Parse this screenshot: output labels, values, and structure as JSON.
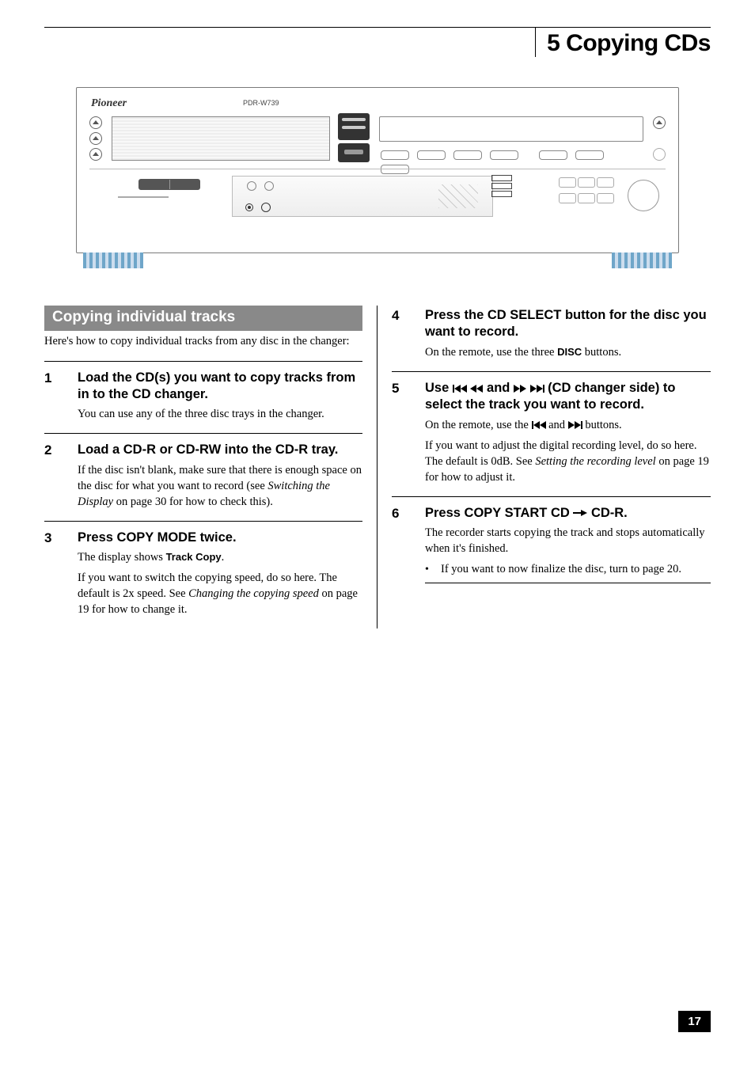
{
  "header": {
    "section_title": "5 Copying CDs"
  },
  "device": {
    "brand": "Pioneer",
    "model": "PDR-W739"
  },
  "subsection": {
    "title": "Copying individual tracks",
    "intro": "Here's how to copy individual tracks from any disc in the changer:"
  },
  "steps_left": [
    {
      "num": "1",
      "title": "Load the CD(s) you want to copy tracks from in to the CD changer.",
      "paras": [
        "You can use any of the three disc trays in the changer."
      ]
    },
    {
      "num": "2",
      "title": "Load a CD-R or CD-RW into the CD-R tray.",
      "paras": [
        "If the disc isn't blank, make sure that there is enough space on the disc for what you want to record (see <span class=\"ital\">Switching the Display</span> on page 30 for how to check this)."
      ]
    },
    {
      "num": "3",
      "title": "Press COPY MODE twice.",
      "paras": [
        "The display shows <span class=\"bold-inline\">Track Copy</span>.",
        "If you want to switch the copying speed, do so here. The default is 2x speed. See <span class=\"ital\">Changing the copying speed</span> on page 19 for how to change it."
      ]
    }
  ],
  "steps_right": [
    {
      "num": "4",
      "title": "Press the CD SELECT button for the disc you want to record.",
      "paras": [
        "On the remote, use the three <span class=\"bold-inline\">DISC</span> buttons."
      ]
    },
    {
      "num": "5",
      "title_html": "Use <span class=\"bar-l\"></span><span class=\"tri tri-l\"></span><span class=\"tri tri-l\"></span> <span class=\"tri tri-l\"></span><span class=\"tri tri-l\"></span> and <span class=\"tri tri-r\"></span><span class=\"tri tri-r\"></span> <span class=\"tri tri-r\"></span><span class=\"tri tri-r\"></span><span class=\"bar-l\"></span> (CD changer side) to select the track you want to record.",
      "paras": [
        "On the remote, use the <span class=\"bar-l\"></span><span class=\"tri tri-l\"></span><span class=\"tri tri-l\"></span> and <span class=\"tri tri-r\"></span><span class=\"tri tri-r\"></span><span class=\"bar-l\"></span> buttons.",
        "If you want to adjust the digital recording level, do so here. The default is 0dB. See <span class=\"ital\">Setting the recording level</span> on page 19 for how to adjust it."
      ]
    },
    {
      "num": "6",
      "title_html": "Press COPY START CD <span class=\"arrow-stem\"></span><span class=\"arrow-r\"></span> CD-R.",
      "paras": [
        "The recorder starts copying the track and stops automatically when it's finished."
      ],
      "bullet": "If you want to now finalize the disc, turn to page 20."
    }
  ],
  "page_number": "17"
}
